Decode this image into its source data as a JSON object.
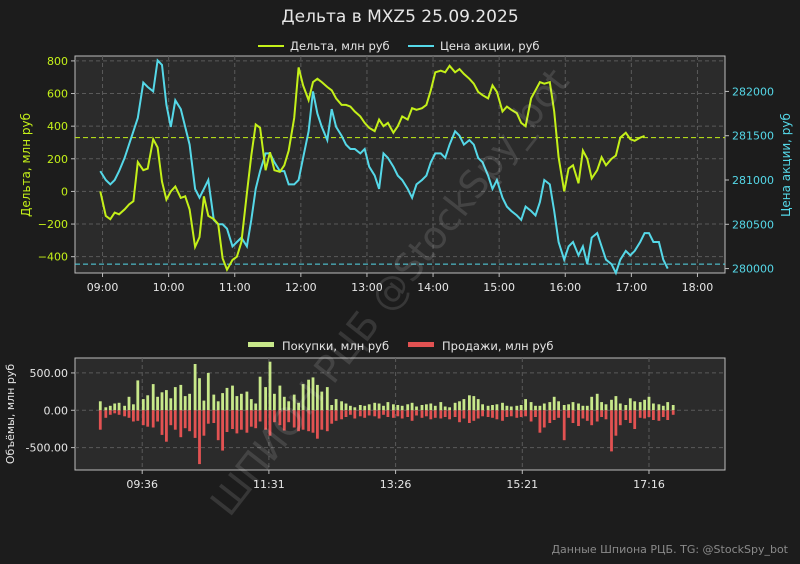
{
  "title": "Дельта в MXZ5 25.09.2025",
  "footer": "Данные Шпиона РЦБ. TG: @StockSpy_bot",
  "watermark": "ШПИОН РЦБ @StockSpy_bot",
  "colors": {
    "background": "#1c1c1c",
    "plot_bg": "#2b2b2b",
    "delta": "#c4f019",
    "price": "#55d8e8",
    "buys": "#c8e88a",
    "sells": "#e25252",
    "text": "#e6e6e6",
    "muted": "#8a8a8a"
  },
  "chart_data": [
    {
      "type": "line",
      "title": "Дельта в MXZ5 25.09.2025",
      "legend": [
        "Дельта, млн руб",
        "Цена акции, руб"
      ],
      "legend_position": "top-center",
      "ylabel_left": "Дельта, млн руб",
      "ylabel_right": "Цена акции, руб",
      "x_ticks": [
        "09:00",
        "10:00",
        "11:00",
        "12:00",
        "13:00",
        "14:00",
        "15:00",
        "16:00",
        "17:00",
        "18:00"
      ],
      "y_left_ticks": [
        -400,
        -200,
        0,
        200,
        400,
        600,
        800
      ],
      "y_right_ticks": [
        280000,
        280500,
        281000,
        281500,
        282000
      ],
      "ylim_left": [
        -500,
        830
      ],
      "ylim_right": [
        279950,
        282400
      ],
      "grid": true,
      "delta_hline": 330,
      "price_hline": 280050,
      "x": [
        "08:58",
        "09:03",
        "09:07",
        "09:11",
        "09:15",
        "09:20",
        "09:24",
        "09:28",
        "09:32",
        "09:37",
        "09:41",
        "09:46",
        "09:50",
        "09:54",
        "09:58",
        "10:02",
        "10:06",
        "10:11",
        "10:15",
        "10:19",
        "10:24",
        "10:28",
        "10:32",
        "10:36",
        "10:41",
        "10:45",
        "10:49",
        "10:53",
        "10:58",
        "11:02",
        "11:06",
        "11:11",
        "11:15",
        "11:19",
        "11:23",
        "11:28",
        "11:32",
        "11:36",
        "11:41",
        "11:45",
        "11:49",
        "11:54",
        "11:58",
        "12:02",
        "12:07",
        "12:11",
        "12:15",
        "12:19",
        "12:24",
        "12:28",
        "12:32",
        "12:37",
        "12:41",
        "12:45",
        "12:49",
        "12:54",
        "12:58",
        "13:02",
        "13:07",
        "13:11",
        "13:15",
        "13:19",
        "13:24",
        "13:28",
        "13:32",
        "13:37",
        "13:41",
        "13:45",
        "13:50",
        "13:54",
        "13:58",
        "14:02",
        "14:07",
        "14:11",
        "14:15",
        "14:20",
        "14:24",
        "14:28",
        "14:33",
        "14:37",
        "14:41",
        "14:45",
        "14:50",
        "14:54",
        "14:58",
        "15:03",
        "15:07",
        "15:11",
        "15:16",
        "15:20",
        "15:24",
        "15:29",
        "15:33",
        "15:37",
        "15:41",
        "15:46",
        "15:50",
        "15:54",
        "15:59",
        "16:03",
        "16:07",
        "16:12",
        "16:16",
        "16:20",
        "16:24",
        "16:29",
        "16:33",
        "16:37",
        "16:42",
        "16:46",
        "16:50",
        "16:55",
        "16:59",
        "17:03",
        "17:08",
        "17:12",
        "17:16",
        "17:20",
        "17:25",
        "17:29",
        "17:33",
        "17:38",
        "17:42",
        "17:46",
        "17:51",
        "17:55"
      ],
      "series": [
        {
          "name": "Дельта, млн руб",
          "axis": "left",
          "values": [
            0,
            -150,
            -170,
            -130,
            -140,
            -110,
            -80,
            -60,
            180,
            130,
            140,
            320,
            270,
            60,
            -50,
            0,
            30,
            -40,
            -30,
            -110,
            -340,
            -280,
            -30,
            -150,
            -170,
            -200,
            -410,
            -480,
            -420,
            -400,
            -310,
            -10,
            220,
            410,
            390,
            130,
            240,
            130,
            120,
            160,
            250,
            450,
            760,
            650,
            560,
            670,
            690,
            670,
            640,
            620,
            570,
            530,
            530,
            520,
            490,
            460,
            420,
            390,
            370,
            440,
            400,
            420,
            360,
            400,
            460,
            440,
            510,
            500,
            510,
            530,
            620,
            730,
            740,
            730,
            770,
            730,
            750,
            720,
            690,
            660,
            610,
            590,
            570,
            650,
            610,
            490,
            520,
            500,
            480,
            420,
            400,
            570,
            620,
            670,
            660,
            670,
            490,
            210,
            0,
            140,
            160,
            50,
            250,
            200,
            80,
            130,
            210,
            160,
            200,
            220,
            330,
            360,
            320,
            310,
            330,
            340
          ],
          "color": "#c4f019"
        },
        {
          "name": "Цена акции, руб",
          "axis": "right",
          "values": [
            281100,
            281000,
            280950,
            281000,
            281100,
            281250,
            281400,
            281550,
            281700,
            282100,
            282050,
            282000,
            282350,
            282300,
            281850,
            281600,
            281900,
            281800,
            281600,
            281400,
            280900,
            280800,
            280900,
            281000,
            280550,
            280500,
            280500,
            280450,
            280250,
            280300,
            280350,
            280250,
            280550,
            280900,
            281100,
            281300,
            281300,
            281200,
            281100,
            281100,
            280950,
            280950,
            281000,
            281250,
            281550,
            282000,
            281750,
            281600,
            281450,
            281800,
            281600,
            281500,
            281400,
            281350,
            281350,
            281300,
            281350,
            281150,
            281050,
            280900,
            281300,
            281250,
            281150,
            281050,
            281000,
            280900,
            280800,
            280950,
            281000,
            281050,
            281200,
            281300,
            281300,
            281250,
            281400,
            281550,
            281500,
            281400,
            281450,
            281400,
            281250,
            281200,
            281050,
            280900,
            281000,
            280800,
            280700,
            280650,
            280600,
            280550,
            280700,
            280650,
            280600,
            280750,
            281000,
            280950,
            280650,
            280300,
            280100,
            280250,
            280300,
            280150,
            280250,
            280050,
            280350,
            280400,
            280250,
            280100,
            280050,
            279950,
            280100,
            280200,
            280150,
            280200,
            280300,
            280400,
            280400,
            280300,
            280300,
            280100,
            280000
          ]
        }
      ]
    },
    {
      "type": "bar",
      "legend": [
        "Покупки, млн руб",
        "Продажи, млн руб"
      ],
      "legend_position": "top-center",
      "ylabel": "Объёмы, млн руб",
      "x_ticks": [
        "09:36",
        "11:31",
        "13:26",
        "15:21",
        "17:16"
      ],
      "y_ticks": [
        "500.00",
        "0.00",
        "-500.00"
      ],
      "ylim": [
        -800,
        700
      ],
      "grid": true,
      "x": [
        "08:58",
        "09:03",
        "09:07",
        "09:11",
        "09:15",
        "09:20",
        "09:24",
        "09:28",
        "09:32",
        "09:37",
        "09:41",
        "09:46",
        "09:50",
        "09:54",
        "09:58",
        "10:02",
        "10:06",
        "10:11",
        "10:15",
        "10:19",
        "10:24",
        "10:28",
        "10:32",
        "10:36",
        "10:41",
        "10:45",
        "10:49",
        "10:53",
        "10:58",
        "11:02",
        "11:06",
        "11:11",
        "11:15",
        "11:19",
        "11:23",
        "11:28",
        "11:32",
        "11:36",
        "11:41",
        "11:45",
        "11:49",
        "11:54",
        "11:58",
        "12:02",
        "12:07",
        "12:11",
        "12:15",
        "12:19",
        "12:24",
        "12:28",
        "12:32",
        "12:37",
        "12:41",
        "12:45",
        "12:49",
        "12:54",
        "12:58",
        "13:02",
        "13:07",
        "13:11",
        "13:15",
        "13:19",
        "13:24",
        "13:28",
        "13:32",
        "13:37",
        "13:41",
        "13:45",
        "13:50",
        "13:54",
        "13:58",
        "14:02",
        "14:07",
        "14:11",
        "14:15",
        "14:20",
        "14:24",
        "14:28",
        "14:33",
        "14:37",
        "14:41",
        "14:45",
        "14:50",
        "14:54",
        "14:58",
        "15:03",
        "15:07",
        "15:11",
        "15:16",
        "15:20",
        "15:24",
        "15:29",
        "15:33",
        "15:37",
        "15:41",
        "15:46",
        "15:50",
        "15:54",
        "15:59",
        "16:03",
        "16:07",
        "16:12",
        "16:16",
        "16:20",
        "16:24",
        "16:29",
        "16:33",
        "16:37",
        "16:42",
        "16:46",
        "16:50",
        "16:55",
        "16:59",
        "17:03",
        "17:08",
        "17:12",
        "17:16",
        "17:20",
        "17:25",
        "17:29",
        "17:33",
        "17:38",
        "17:42",
        "17:46",
        "17:51",
        "17:55"
      ],
      "series": [
        {
          "name": "Покупки, млн руб",
          "values": [
            120,
            40,
            60,
            90,
            100,
            60,
            180,
            80,
            400,
            150,
            200,
            350,
            180,
            240,
            270,
            160,
            310,
            340,
            190,
            220,
            620,
            430,
            130,
            500,
            210,
            120,
            230,
            300,
            330,
            190,
            220,
            250,
            150,
            90,
            450,
            310,
            650,
            220,
            330,
            180,
            120,
            210,
            100,
            350,
            410,
            440,
            340,
            250,
            310,
            70,
            150,
            120,
            90,
            60,
            40,
            70,
            60,
            80,
            100,
            90,
            60,
            110,
            80,
            70,
            60,
            80,
            100,
            50,
            70,
            80,
            90,
            60,
            110,
            50,
            40,
            100,
            120,
            150,
            200,
            190,
            150,
            80,
            60,
            70,
            80,
            100,
            60,
            50,
            60,
            70,
            150,
            110,
            60,
            60,
            90,
            110,
            180,
            120,
            70,
            80,
            110,
            90,
            60,
            60,
            180,
            220,
            110,
            80,
            140,
            190,
            90,
            70,
            160,
            120,
            110,
            140,
            180,
            90,
            80,
            60,
            110,
            70
          ],
          "color": "#c8e88a"
        },
        {
          "name": "Продажи, млн руб",
          "values": [
            -260,
            -100,
            -60,
            -40,
            -60,
            -80,
            -100,
            -150,
            -140,
            -200,
            -220,
            -230,
            -150,
            -330,
            -420,
            -200,
            -260,
            -360,
            -240,
            -280,
            -370,
            -720,
            -340,
            -180,
            -170,
            -400,
            -540,
            -290,
            -250,
            -310,
            -260,
            -300,
            -220,
            -240,
            -150,
            -260,
            -340,
            -160,
            -200,
            -270,
            -160,
            -230,
            -280,
            -260,
            -280,
            -300,
            -380,
            -260,
            -280,
            -180,
            -140,
            -120,
            -90,
            -60,
            -110,
            -80,
            -100,
            -70,
            -80,
            -110,
            -60,
            -90,
            -100,
            -80,
            -110,
            -90,
            -140,
            -70,
            -100,
            -80,
            -120,
            -100,
            -110,
            -90,
            -120,
            -90,
            -160,
            -110,
            -170,
            -140,
            -110,
            -80,
            -90,
            -100,
            -120,
            -140,
            -90,
            -80,
            -100,
            -90,
            -80,
            -150,
            -90,
            -300,
            -230,
            -170,
            -130,
            -100,
            -400,
            -100,
            -170,
            -210,
            -110,
            -140,
            -200,
            -150,
            -90,
            -120,
            -550,
            -340,
            -200,
            -130,
            -170,
            -250,
            -100,
            -110,
            -90,
            -130,
            -140,
            -90,
            -130,
            -60
          ]
        }
      ]
    }
  ]
}
